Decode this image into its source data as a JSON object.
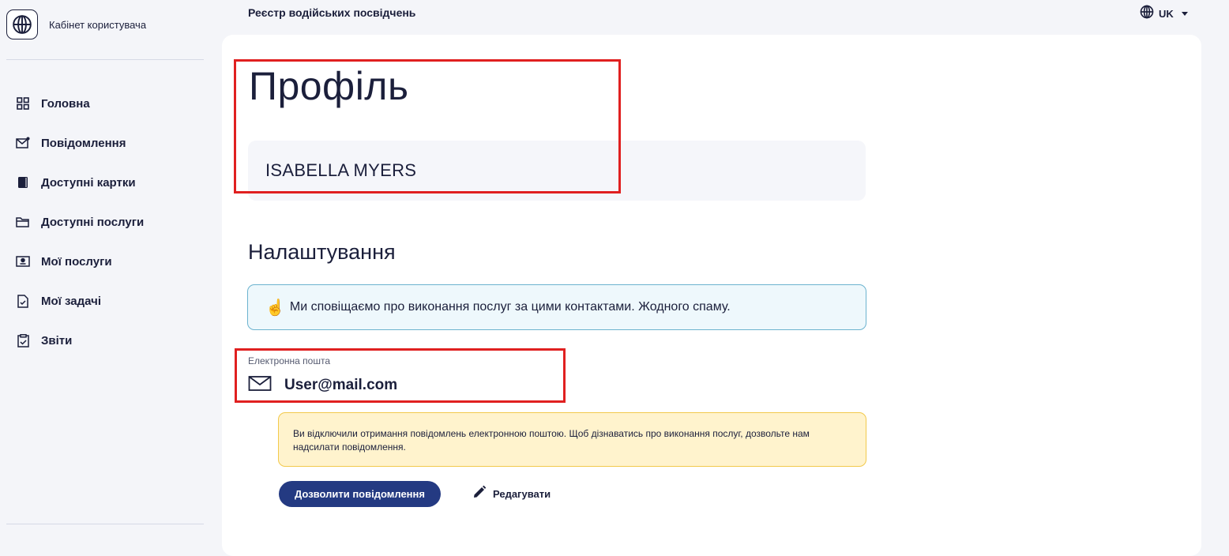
{
  "sidebar": {
    "brand": "Кабінет користувача",
    "items": [
      {
        "label": "Головна",
        "icon": "grid-icon"
      },
      {
        "label": "Повідомлення",
        "icon": "mail-notification-icon"
      },
      {
        "label": "Доступні картки",
        "icon": "card-book-icon"
      },
      {
        "label": "Доступні послуги",
        "icon": "folder-icon"
      },
      {
        "label": "Мої послуги",
        "icon": "id-card-icon"
      },
      {
        "label": "Мої задачі",
        "icon": "task-check-icon"
      },
      {
        "label": "Звіти",
        "icon": "clipboard-check-icon"
      }
    ]
  },
  "header": {
    "title": "Реєстр водійських посвідчень",
    "language": "UK"
  },
  "profile": {
    "title": "Профіль",
    "name": "ISABELLA MYERS"
  },
  "settings": {
    "title": "Налаштування",
    "info_emoji": "☝️",
    "info_text": "Ми сповіщаємо про виконання послуг за цими контактами. Жодного спаму.",
    "email_label": "Електронна пошта",
    "email_value": "User@mail.com",
    "warning_text": "Ви відключили отримання повідомлень електронною поштою. Щоб дізнаватись про виконання послуг, дозвольте нам надсилати повідомлення.",
    "allow_button": "Дозволити повідомлення",
    "edit_button": "Редагувати"
  },
  "colors": {
    "primary": "#243a82",
    "highlight": "#e02020",
    "info_bg": "#eef8fc",
    "warning_bg": "#fff3cd"
  }
}
